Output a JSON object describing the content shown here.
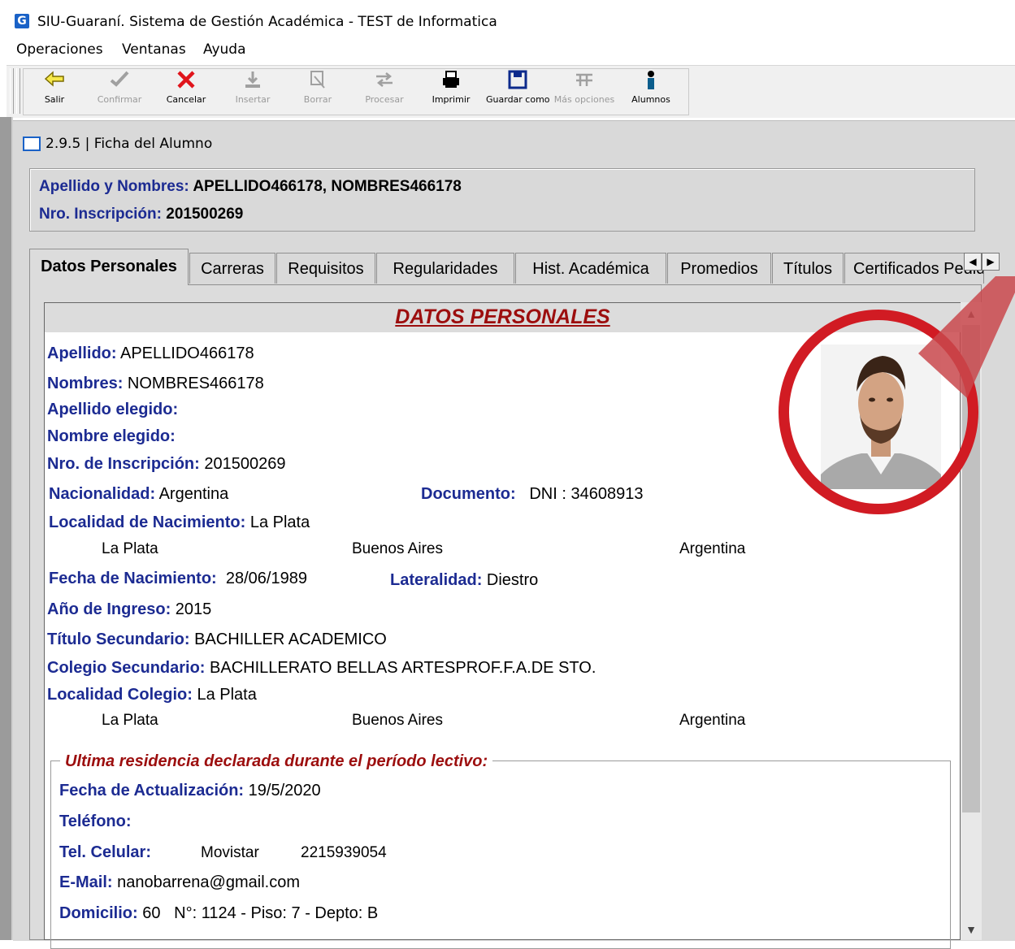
{
  "window": {
    "title": "SIU-Guaraní. Sistema de Gestión Académica -  TEST de Informatica",
    "logo_letter": "G"
  },
  "menu": [
    "Operaciones",
    "Ventanas",
    "Ayuda"
  ],
  "toolbar": [
    {
      "label": "Salir",
      "icon": "exit-arrow-icon",
      "enabled": true
    },
    {
      "label": "Confirmar",
      "icon": "check-icon",
      "enabled": false
    },
    {
      "label": "Cancelar",
      "icon": "cancel-x-icon",
      "enabled": true
    },
    {
      "label": "Insertar",
      "icon": "insert-icon",
      "enabled": false
    },
    {
      "label": "Borrar",
      "icon": "erase-icon",
      "enabled": false
    },
    {
      "label": "Procesar",
      "icon": "process-icon",
      "enabled": false
    },
    {
      "label": "Imprimir",
      "icon": "print-icon",
      "enabled": true
    },
    {
      "label": "Guardar como",
      "icon": "save-icon",
      "enabled": true
    },
    {
      "label": "Más opciones",
      "icon": "more-options-icon",
      "enabled": false
    },
    {
      "label": "Alumnos",
      "icon": "students-icon",
      "enabled": true
    }
  ],
  "child_window": {
    "title": "2.9.5 | Ficha del Alumno"
  },
  "header": {
    "name_label": "Apellido y Nombres:",
    "name_value": "APELLIDO466178, NOMBRES466178",
    "inscription_label": "Nro. Inscripción:",
    "inscription_value": "201500269"
  },
  "tabs": [
    "Datos Personales",
    "Carreras",
    "Requisitos",
    "Regularidades",
    "Hist. Académica",
    "Promedios",
    "Títulos",
    "Certificados Pedidos"
  ],
  "active_tab": "Datos Personales",
  "section_title": "DATOS PERSONALES",
  "fields": {
    "apellido": {
      "label": "Apellido:",
      "value": "APELLIDO466178"
    },
    "nombres": {
      "label": "Nombres:",
      "value": "NOMBRES466178"
    },
    "apellido_elegido": {
      "label": "Apellido elegido:",
      "value": ""
    },
    "nombre_elegido": {
      "label": "Nombre elegido:",
      "value": ""
    },
    "nro_inscripcion": {
      "label": "Nro. de Inscripción:",
      "value": "201500269"
    },
    "nacionalidad": {
      "label": "Nacionalidad:",
      "value": "Argentina"
    },
    "documento": {
      "label": "Documento:",
      "value": "DNI :  34608913"
    },
    "localidad_nacimiento": {
      "label": "Localidad de Nacimiento:",
      "value": "La Plata",
      "city": "La Plata",
      "province": "Buenos Aires",
      "country": "Argentina"
    },
    "fecha_nacimiento": {
      "label": "Fecha de Nacimiento:",
      "value": "28/06/1989"
    },
    "lateralidad": {
      "label": "Lateralidad:",
      "value": "Diestro"
    },
    "anio_ingreso": {
      "label": "Año de Ingreso:",
      "value": "2015"
    },
    "titulo_secundario": {
      "label": "Título Secundario:",
      "value": "BACHILLER ACADEMICO"
    },
    "colegio_secundario": {
      "label": "Colegio Secundario:",
      "value": "BACHILLERATO BELLAS ARTESPROF.F.A.DE STO."
    },
    "localidad_colegio": {
      "label": "Localidad Colegio:",
      "value": "La Plata",
      "city": "La Plata",
      "province": "Buenos Aires",
      "country": "Argentina"
    }
  },
  "residencia": {
    "legend": "Ultima residencia declarada durante el período lectivo:",
    "fecha_actualizacion": {
      "label": "Fecha de Actualización:",
      "value": "19/5/2020"
    },
    "telefono": {
      "label": "Teléfono:",
      "value": ""
    },
    "celular": {
      "label": "Tel. Celular:",
      "carrier": "Movistar",
      "value": "2215939054"
    },
    "email": {
      "label": "E-Mail:",
      "value": "nanobarrena@gmail.com"
    },
    "domicilio": {
      "label": "Domicilio:",
      "street": "60",
      "numero": "N°: 1124",
      "piso": " - Piso: 7",
      "depto": " - Depto: B"
    }
  },
  "colors": {
    "label_blue": "#1c2b92",
    "section_red": "#9c0e0e",
    "highlight_red": "#d11b23",
    "panel_gray": "#d9d9d9"
  }
}
